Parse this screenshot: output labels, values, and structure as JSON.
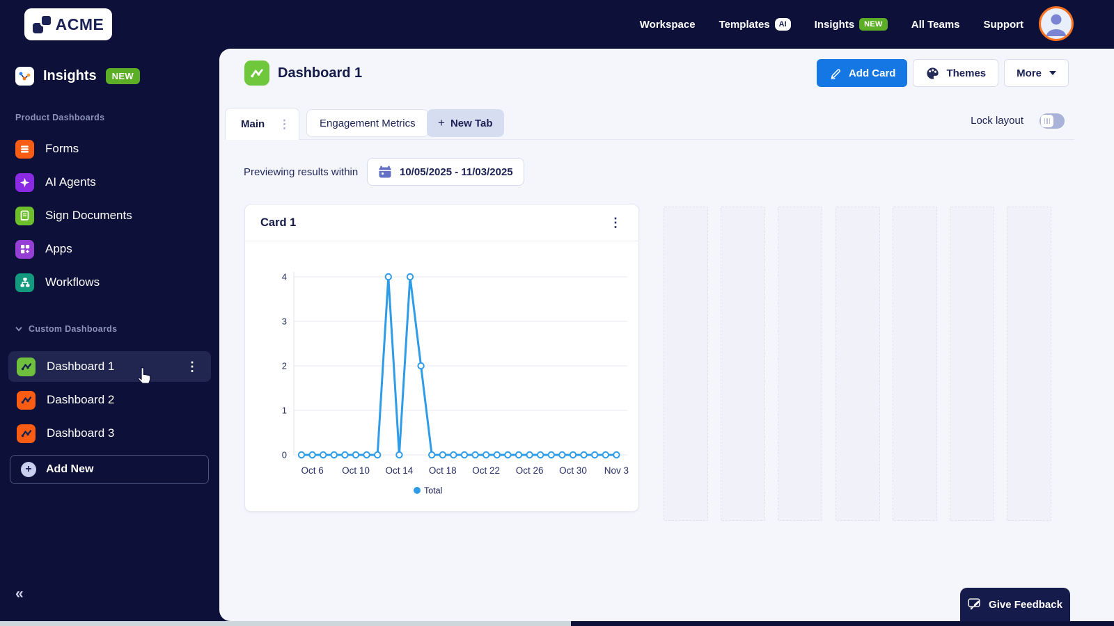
{
  "topbar": {
    "logo": "ACME",
    "nav": [
      {
        "label": "Workspace"
      },
      {
        "label": "Templates",
        "badge": "AI"
      },
      {
        "label": "Insights",
        "badge": "NEW"
      },
      {
        "label": "All Teams"
      },
      {
        "label": "Support"
      }
    ]
  },
  "sidebar": {
    "app": {
      "label": "Insights",
      "badge": "NEW"
    },
    "section_products": "Product Dashboards",
    "products": [
      {
        "label": "Forms"
      },
      {
        "label": "AI Agents"
      },
      {
        "label": "Sign Documents"
      },
      {
        "label": "Apps"
      },
      {
        "label": "Workflows"
      }
    ],
    "section_custom": "Custom Dashboards",
    "dashboards": [
      {
        "label": "Dashboard 1",
        "selected": true
      },
      {
        "label": "Dashboard 2",
        "selected": false
      },
      {
        "label": "Dashboard 3",
        "selected": false
      }
    ],
    "add_new": "Add New",
    "collapse": "«"
  },
  "header": {
    "title": "Dashboard 1",
    "add_card": "Add Card",
    "themes": "Themes",
    "more": "More"
  },
  "tabs": {
    "active": "Main",
    "second": "Engagement Metrics",
    "new_tab": "New Tab",
    "new_tab_plus": "+",
    "lock_label": "Lock layout",
    "lock_on": false
  },
  "preview": {
    "label": "Previewing results within",
    "range": "10/05/2025 - 11/03/2025"
  },
  "card": {
    "title": "Card 1"
  },
  "chart_data": {
    "type": "line",
    "title": "",
    "x": [
      "Oct 5",
      "Oct 6",
      "Oct 7",
      "Oct 8",
      "Oct 9",
      "Oct 10",
      "Oct 11",
      "Oct 12",
      "Oct 13",
      "Oct 14",
      "Oct 15",
      "Oct 16",
      "Oct 17",
      "Oct 18",
      "Oct 19",
      "Oct 20",
      "Oct 21",
      "Oct 22",
      "Oct 23",
      "Oct 24",
      "Oct 25",
      "Oct 26",
      "Oct 27",
      "Oct 28",
      "Oct 29",
      "Oct 30",
      "Oct 31",
      "Nov 1",
      "Nov 2",
      "Nov 3"
    ],
    "series": [
      {
        "name": "Total",
        "color": "#2F9CE8",
        "values": [
          0,
          0,
          0,
          0,
          0,
          0,
          0,
          0,
          4,
          0,
          4,
          2,
          0,
          0,
          0,
          0,
          0,
          0,
          0,
          0,
          0,
          0,
          0,
          0,
          0,
          0,
          0,
          0,
          0,
          0
        ]
      }
    ],
    "x_tick_labels": [
      "Oct 6",
      "Oct 10",
      "Oct 14",
      "Oct 18",
      "Oct 22",
      "Oct 26",
      "Oct 30",
      "Nov 3"
    ],
    "y_ticks": [
      0,
      1,
      2,
      3,
      4
    ],
    "ylim": [
      0,
      4
    ],
    "grid": "horizontal",
    "legend_position": "bottom"
  },
  "feedback": {
    "label": "Give Feedback"
  },
  "colors": {
    "navy_bg": "#0D1038",
    "panel_bg": "#F5F6FC",
    "primary_blue": "#1577E3",
    "chart_blue": "#2F9CE8",
    "green_badge": "#5CAE27",
    "green_tile": "#6FC13D",
    "orange_tile": "#F95C12",
    "purple_tile": "#8A2AE2",
    "teal_tile": "#12997E",
    "avatar_ring": "#F9701F"
  }
}
